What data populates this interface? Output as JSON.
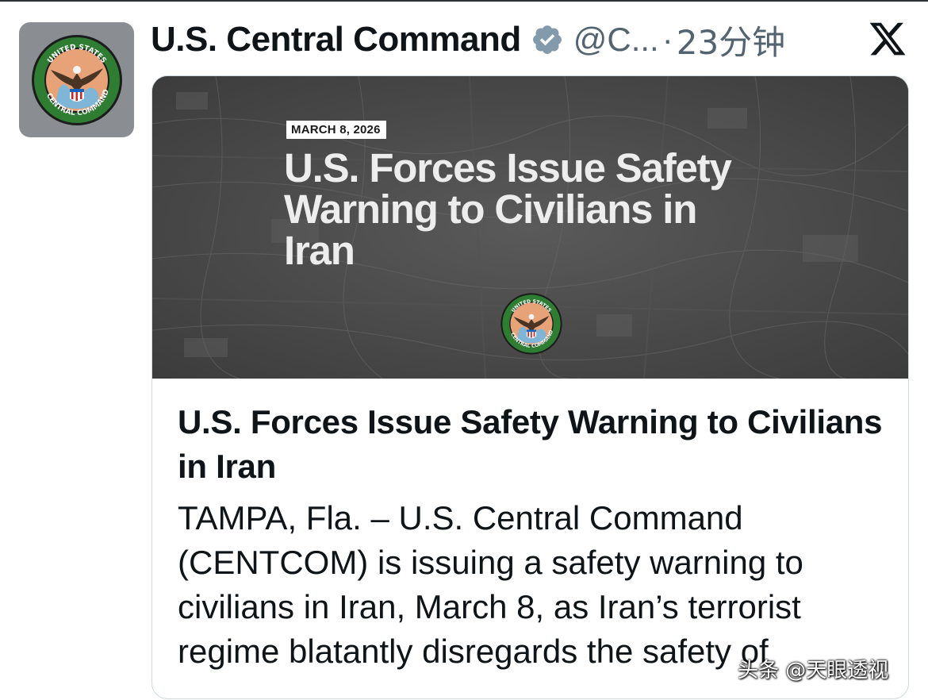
{
  "post": {
    "display_name": "U.S. Central Command",
    "handle": "@C...",
    "separator": "·",
    "timestamp": "23分钟",
    "avatar_icon": "centcom-seal-icon",
    "verified_icon": "verified-badge-icon",
    "platform_icon": "x-logo-icon"
  },
  "card": {
    "image": {
      "date_tag": "MARCH 8, 2026",
      "headline": "U.S. Forces Issue Safety Warning to Civilians in Iran",
      "seal_icon": "centcom-seal-icon"
    },
    "title": "U.S. Forces Issue Safety Warning to Civilians in Iran",
    "body": "TAMPA, Fla. – U.S. Central Command (CENTCOM) is issuing a safety warning to civilians in Iran, March 8, as Iran’s terrorist regime blatantly disregards the safety of"
  },
  "watermark": "头条 @天眼透视",
  "colors": {
    "text_primary": "#0f1419",
    "text_secondary": "#536471",
    "verified_badge": "#829aab",
    "card_border": "#cfd9de",
    "image_background": "#4a4a4a"
  }
}
